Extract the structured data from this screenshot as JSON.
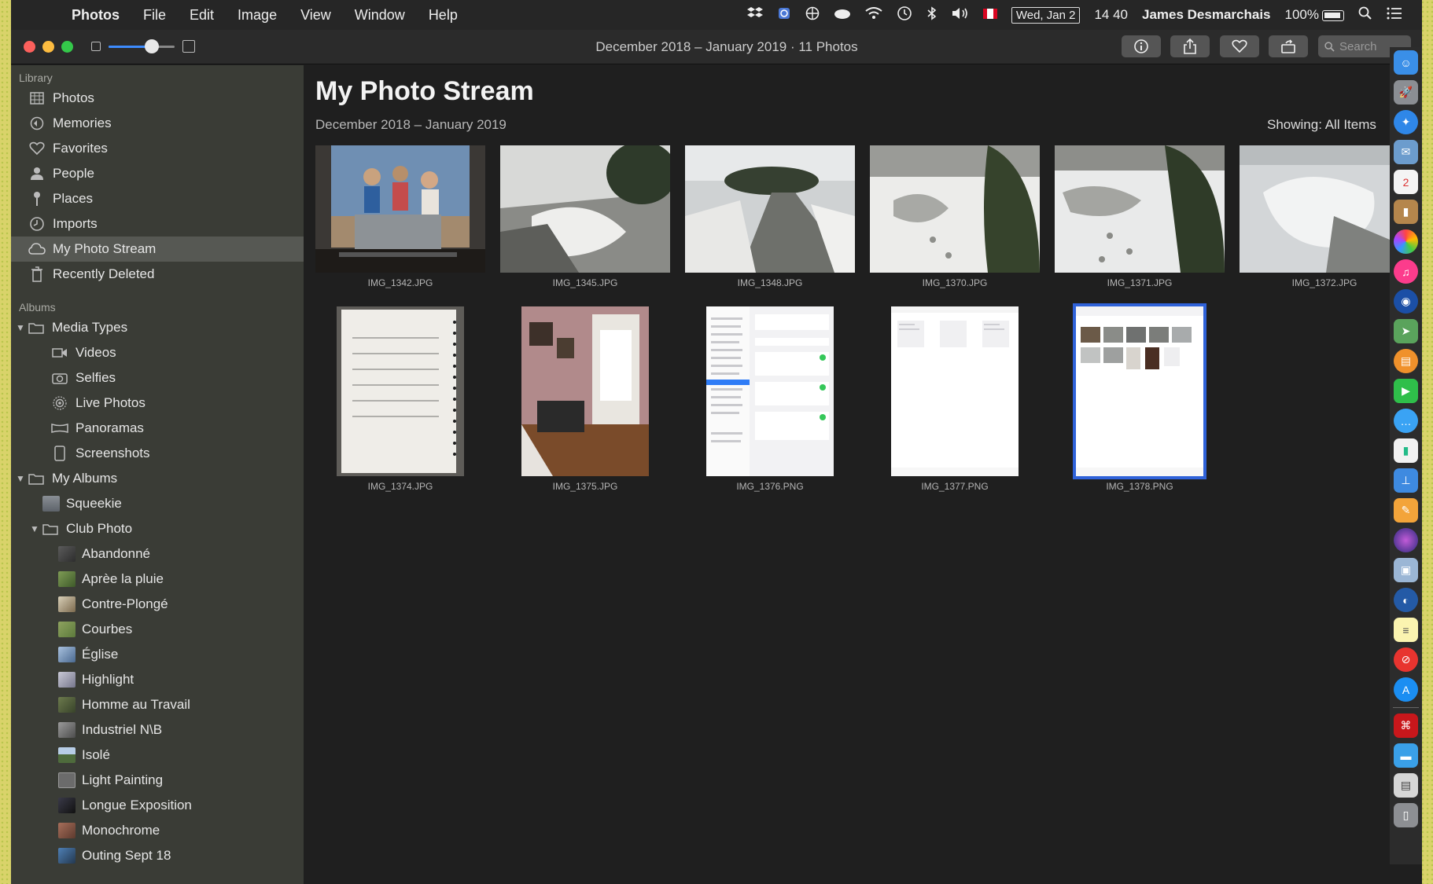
{
  "menubar": {
    "app": "Photos",
    "menus": [
      "File",
      "Edit",
      "Image",
      "View",
      "Window",
      "Help"
    ],
    "date": "Wed, Jan 2",
    "time": "14 40",
    "user": "James Desmarchais",
    "battery": "100%"
  },
  "toolbar": {
    "title": "December 2018 – January 2019 · 11 Photos",
    "search_placeholder": "Search",
    "zoom_level": 0.62
  },
  "sidebar": {
    "library_header": "Library",
    "library": [
      {
        "label": "Photos",
        "icon": "photos-icon"
      },
      {
        "label": "Memories",
        "icon": "memories-icon"
      },
      {
        "label": "Favorites",
        "icon": "heart-icon"
      },
      {
        "label": "People",
        "icon": "person-icon"
      },
      {
        "label": "Places",
        "icon": "pin-icon"
      },
      {
        "label": "Imports",
        "icon": "clock-icon"
      },
      {
        "label": "My Photo Stream",
        "icon": "cloud-icon",
        "selected": true
      },
      {
        "label": "Recently Deleted",
        "icon": "trash-icon"
      }
    ],
    "albums_header": "Albums",
    "media_types": "Media Types",
    "media": [
      "Videos",
      "Selfies",
      "Live Photos",
      "Panoramas",
      "Screenshots"
    ],
    "my_albums": "My Albums",
    "squeekie": "Squeekie",
    "club_photo": "Club Photo",
    "club_albums": [
      "Abandonné",
      "Aprèe la pluie",
      "Contre-Plongé",
      "Courbes",
      "Église",
      "Highlight",
      "Homme au Travail",
      "Industriel N\\B",
      "Isolé",
      "Light Painting",
      "Longue Exposition",
      "Monochrome",
      "Outing Sept 18"
    ]
  },
  "main": {
    "title": "My Photo Stream",
    "subtitle": "December 2018 – January 2019",
    "showing": "Showing: All Items",
    "photos": [
      {
        "name": "IMG_1342.JPG",
        "kind": "kids"
      },
      {
        "name": "IMG_1345.JPG",
        "kind": "snow"
      },
      {
        "name": "IMG_1348.JPG",
        "kind": "snow"
      },
      {
        "name": "IMG_1370.JPG",
        "kind": "snow"
      },
      {
        "name": "IMG_1371.JPG",
        "kind": "snow"
      },
      {
        "name": "IMG_1372.JPG",
        "kind": "snow"
      },
      {
        "name": "IMG_1374.JPG",
        "kind": "notebook"
      },
      {
        "name": "IMG_1375.JPG",
        "kind": "room"
      },
      {
        "name": "IMG_1376.PNG",
        "kind": "settings"
      },
      {
        "name": "IMG_1377.PNG",
        "kind": "blank"
      },
      {
        "name": "IMG_1378.PNG",
        "kind": "grid",
        "selected": true
      }
    ]
  }
}
